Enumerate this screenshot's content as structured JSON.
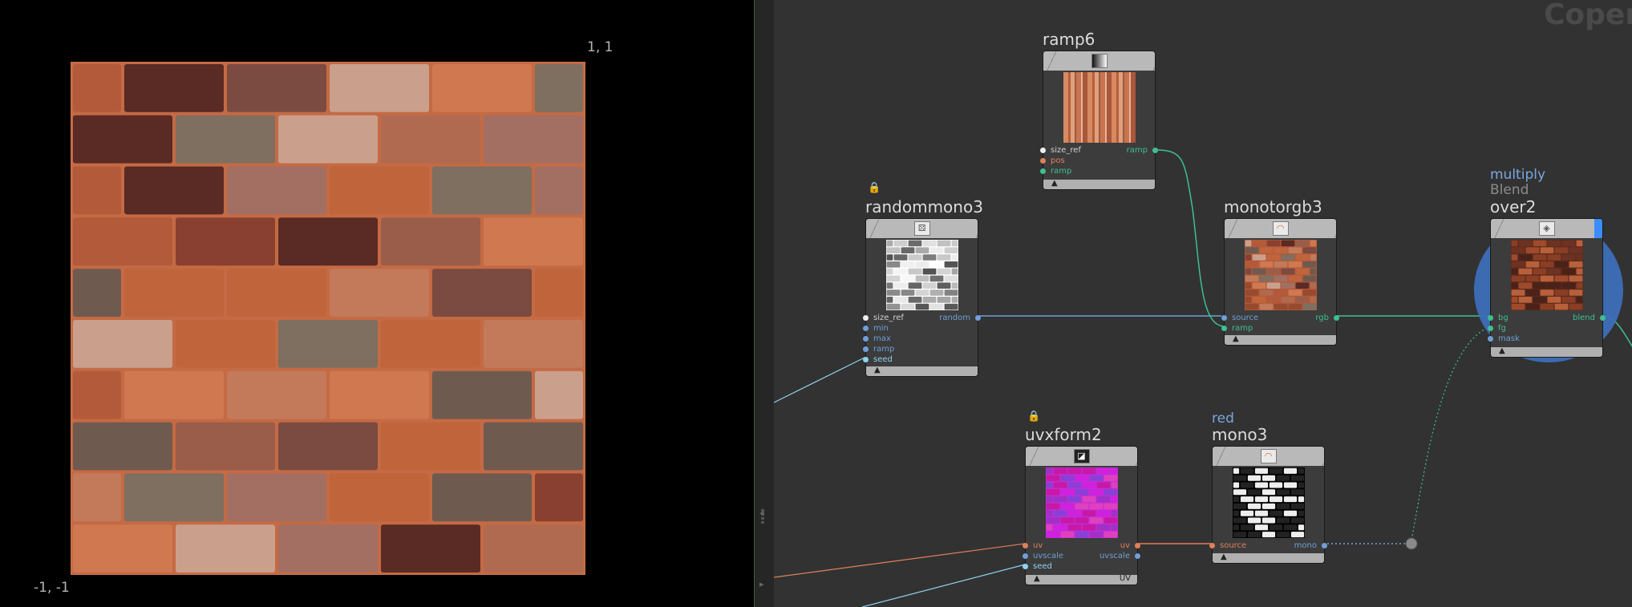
{
  "viewer": {
    "coord_top_right": "1, 1",
    "coord_bottom_left": "-1, -1"
  },
  "network": {
    "context_label": "Copern",
    "nodes": {
      "ramp6": {
        "title": "ramp6",
        "inputs": [
          "size_ref",
          "pos",
          "ramp"
        ],
        "output": "ramp"
      },
      "randommono3": {
        "title": "randommono3",
        "inputs": [
          "size_ref",
          "min",
          "max",
          "ramp",
          "seed"
        ],
        "output": "random"
      },
      "monotorgb3": {
        "title": "monotorgb3",
        "inputs": [
          "source",
          "ramp"
        ],
        "output": "rgb"
      },
      "over2": {
        "subtitle_mode": "multiply",
        "subtitle_type": "Blend",
        "title": "over2",
        "inputs": [
          "bg",
          "fg",
          "mask"
        ],
        "output": "blend"
      },
      "uvxform2": {
        "title": "uvxform2",
        "inputs": [
          "uv",
          "uvscale",
          "seed"
        ],
        "outputs": [
          "uv",
          "uvscale"
        ],
        "footer_right": "UV"
      },
      "mono3": {
        "subtitle": "red",
        "title": "mono3",
        "input": "source",
        "output": "mono"
      }
    }
  },
  "colors": {
    "viewer_bg": "#000000",
    "network_bg": "#323232",
    "brick_mortar": "#c9714a",
    "wire_blue": "#6f9fd8",
    "wire_green": "#3fbf8f",
    "wire_cyan": "#8fd3ef",
    "wire_orange": "#e0805a",
    "selection": "#3d6fb8"
  }
}
